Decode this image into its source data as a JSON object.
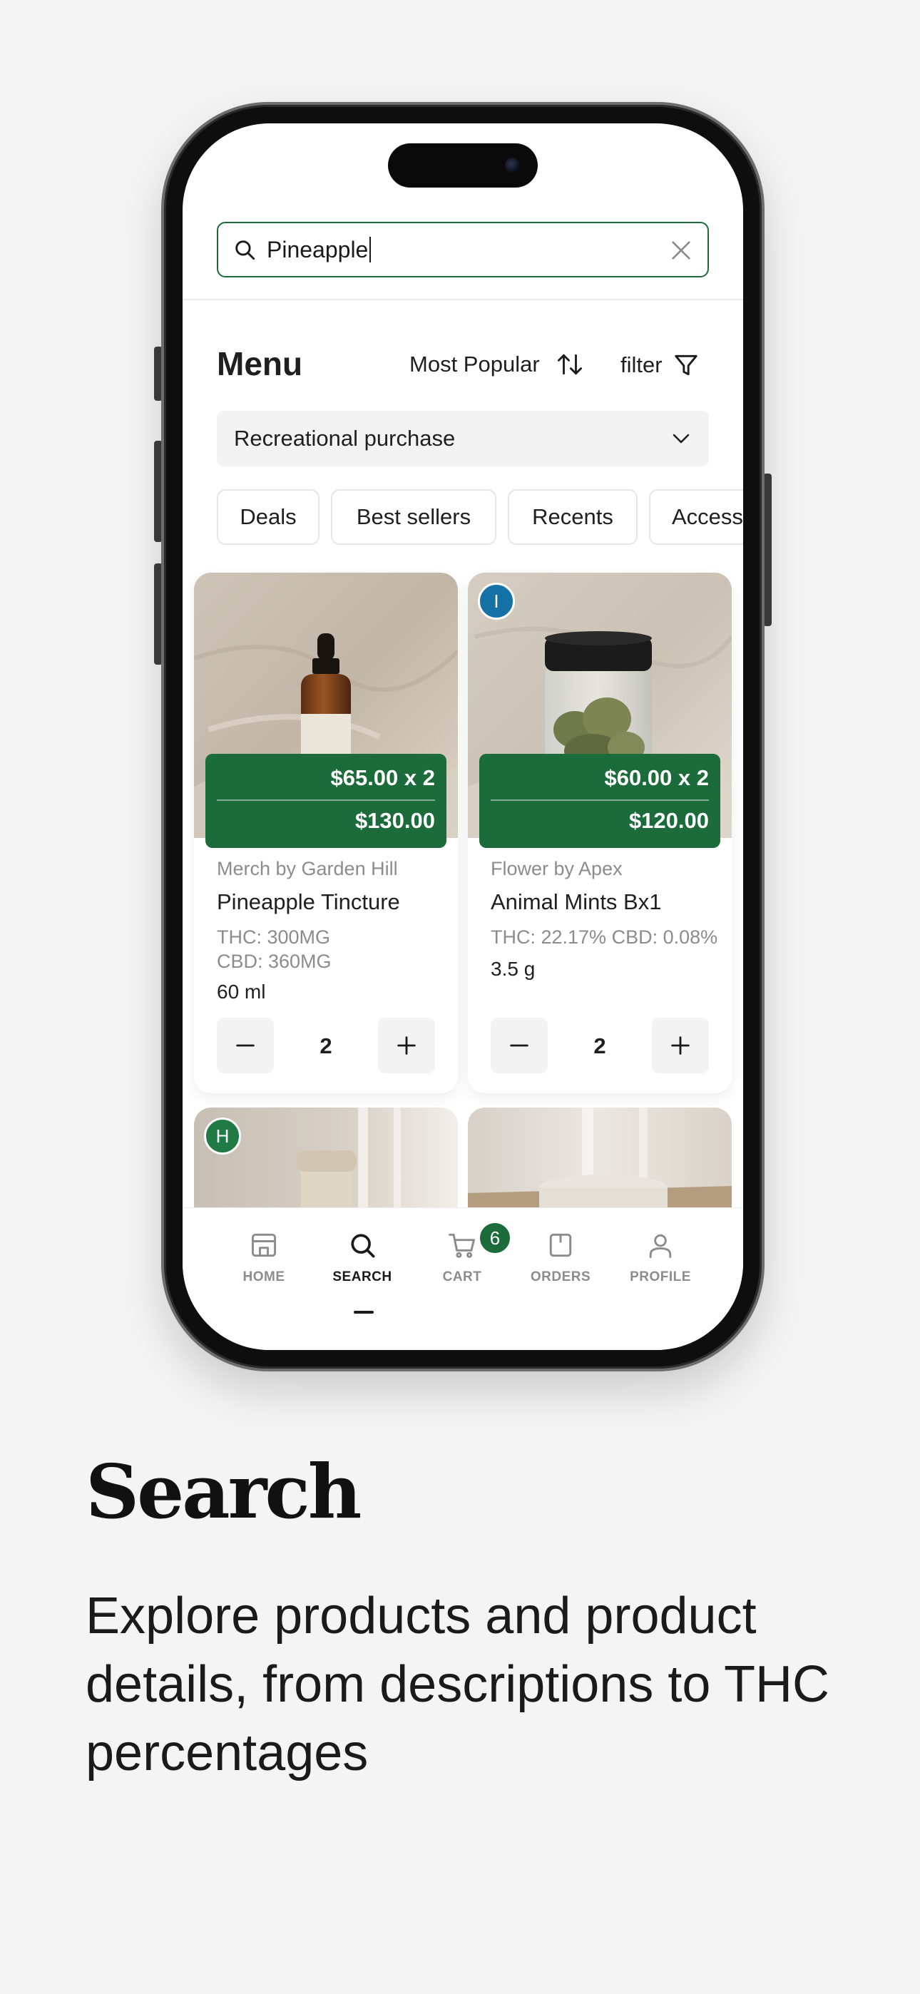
{
  "search": {
    "value": "Pineapple"
  },
  "menu": {
    "title": "Menu",
    "sort_label": "Most Popular",
    "filter_label": "filter",
    "purchase_type": "Recreational purchase"
  },
  "categories": [
    {
      "label": "Deals"
    },
    {
      "label": "Best sellers"
    },
    {
      "label": "Recents"
    },
    {
      "label": "Access"
    }
  ],
  "products": [
    {
      "brand": "Merch by Garden Hill",
      "name": "Pineapple Tincture",
      "cannabinoids": "THC: 300MG\nCBD: 360MG",
      "size": "60 ml",
      "unit_price": "$65.00 x 2",
      "total": "$130.00",
      "quantity": "2",
      "badge": ""
    },
    {
      "brand": "Flower by Apex",
      "name": "Animal Mints Bx1",
      "cannabinoids": "THC: 22.17% CBD: 0.08%",
      "size": "3.5 g",
      "unit_price": "$60.00 x 2",
      "total": "$120.00",
      "quantity": "2",
      "badge": "I"
    },
    {
      "badge": "H"
    },
    {
      "badge": ""
    }
  ],
  "tabs": [
    {
      "label": "HOME",
      "icon": "store-icon"
    },
    {
      "label": "SEARCH",
      "icon": "search-icon",
      "active": true
    },
    {
      "label": "CART",
      "icon": "cart-icon",
      "badge": "6"
    },
    {
      "label": "ORDERS",
      "icon": "orders-icon"
    },
    {
      "label": "PROFILE",
      "icon": "user-icon"
    }
  ],
  "caption": {
    "title": "Search",
    "body": "Explore products and product details, from descriptions to THC percentages"
  },
  "colors": {
    "accent": "#1c6b3a",
    "badge_blue": "#1572a6",
    "background": "#f4f4f4"
  }
}
